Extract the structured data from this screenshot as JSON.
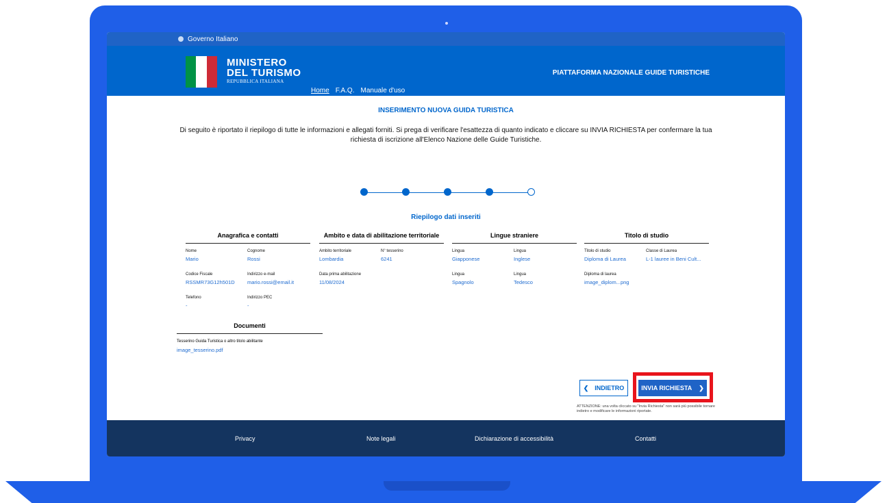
{
  "gov_bar": {
    "label": "Governo Italiano"
  },
  "header": {
    "logo_line1": "MINISTERO",
    "logo_line2": "DEL TURISMO",
    "logo_line3": "REPUBBLICA ITALIANA",
    "platform": "PIATTAFORMA NAZIONALE GUIDE TURISTICHE",
    "nav": [
      "Home",
      "F.A.Q.",
      "Manuale d'uso"
    ]
  },
  "main": {
    "title": "INSERIMENTO NUOVA GUIDA TURISTICA",
    "intro": "Di seguito è riportato il riepilogo di tutte le informazioni e allegati forniti. Si prega di verificare l'esattezza di quanto indicato e cliccare su INVIA RICHIESTA per confermare la tua richiesta di iscrizione all'Elenco Nazione delle Guide Turistiche.",
    "recap_title": "Riepilogo dati inseriti"
  },
  "sections": [
    {
      "title": "Anagrafica e contatti",
      "fields": [
        {
          "label": "Nome",
          "value": "Mario"
        },
        {
          "label": "Cognome",
          "value": "Rossi"
        },
        {
          "label": "Codice Fiscale",
          "value": "RSSMR73G12h501D"
        },
        {
          "label": "Indirizzo e-mail",
          "value": "mario.rossi@email.it"
        },
        {
          "label": "Telefono",
          "value": "-"
        },
        {
          "label": "Indirizzo PEC",
          "value": "-"
        }
      ]
    },
    {
      "title": "Ambito e data di abilitazione territoriale",
      "fields": [
        {
          "label": "Ambito territoriale",
          "value": "Lombardia"
        },
        {
          "label": "N° tesserino",
          "value": "6241"
        },
        {
          "label": "Data prima abilitazione",
          "value": "11/08/2024"
        }
      ]
    },
    {
      "title": "Lingue straniere",
      "fields": [
        {
          "label": "Lingua",
          "value": "Giapponese"
        },
        {
          "label": "Lingua",
          "value": "Inglese"
        },
        {
          "label": "Lingua",
          "value": "Spagnolo"
        },
        {
          "label": "Lingua",
          "value": "Tedesco"
        }
      ]
    },
    {
      "title": "Titolo di studio",
      "fields": [
        {
          "label": "Titolo di studio",
          "value": "Diploma di Laurea"
        },
        {
          "label": "Classe di Laurea",
          "value": "L-1 lauree in Beni Cult..."
        },
        {
          "label": "Diploma di laurea",
          "value": "image_diplom...png"
        }
      ]
    }
  ],
  "documents": {
    "title": "Documenti",
    "label": "Tesserino Guida Turistica o altro titolo abilitante",
    "value": "image_tesserino.pdf"
  },
  "actions": {
    "back": "INDIETRO",
    "send": "INVIA RICHIESTA",
    "warning": "ATTENZIONE: una volta cliccato su \"Invia Richiesta\" non sarà più possibile tornare indietro e modificare le informazioni riportate."
  },
  "footer": [
    "Privacy",
    "Note legali",
    "Dichiarazione di accessibilità",
    "Contatti"
  ],
  "colors": {
    "primary": "#0066cc",
    "laptop": "#1f5fe8",
    "footer": "#14345f",
    "highlight": "#e8141c"
  }
}
